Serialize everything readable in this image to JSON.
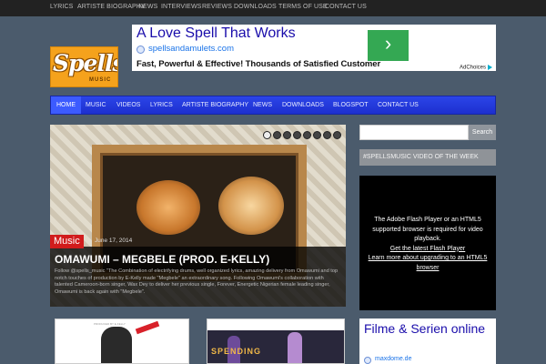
{
  "topbar": {
    "links": [
      "LYRICS",
      "ARTISTE BIOGRAPHY",
      "NEWS",
      "INTERVIEWS",
      "REVIEWS",
      "DOWNLOADS",
      "TERMS OF USE",
      "CONTACT US"
    ]
  },
  "logo": {
    "word": "Spells",
    "sub": "MUSIC"
  },
  "ad_top": {
    "headline": "A Love Spell That Works",
    "url": "spellsandamulets.com",
    "description": "Fast, Powerful & Effective! Thousands of Satisfied Customer",
    "go_glyph": "›",
    "choices_label": "AdChoices"
  },
  "mainnav": {
    "items": [
      "HOME",
      "MUSIC",
      "VIDEOS",
      "LYRICS",
      "ARTISTE BIOGRAPHY",
      "NEWS",
      "DOWNLOADS",
      "BLOGSPOT",
      "CONTACT US"
    ]
  },
  "slider": {
    "category": "Music",
    "date": "June 17, 2014",
    "title": "OMAWUMI – MEGBELE (PROD. E-KELLY)",
    "excerpt": "Follow @spells_music \"The Combination of electrifying drums, well organized lyrics, amazing delivery from Omawumi and top notch touches of production by E-Kelly made \"Megbele\" an extraordinary song. Following Omawumi's collaboration with talented Cameroon-born singer, Wax Dey to deliver her previous single, Forever, Energetic Nigerian female leading singer, Omawumi is back again with \"Megbele\"."
  },
  "thumbs": {
    "first_caption": "PRODUCED BY E-KELLY",
    "second_word": "SPENDING"
  },
  "sidebar": {
    "search_button": "Search",
    "video_widget_title": "#SPELLSMUSIC VIDEO OF THE WEEK",
    "flash_message": "The Adobe Flash Player or an HTML5 supported browser is required for video playback.",
    "flash_link1": "Get the latest Flash Player",
    "flash_link2": "Learn more about upgrading to an HTML5 browser"
  },
  "ad_side": {
    "headline": "Filme & Serien online",
    "url": "maxdome.de"
  }
}
